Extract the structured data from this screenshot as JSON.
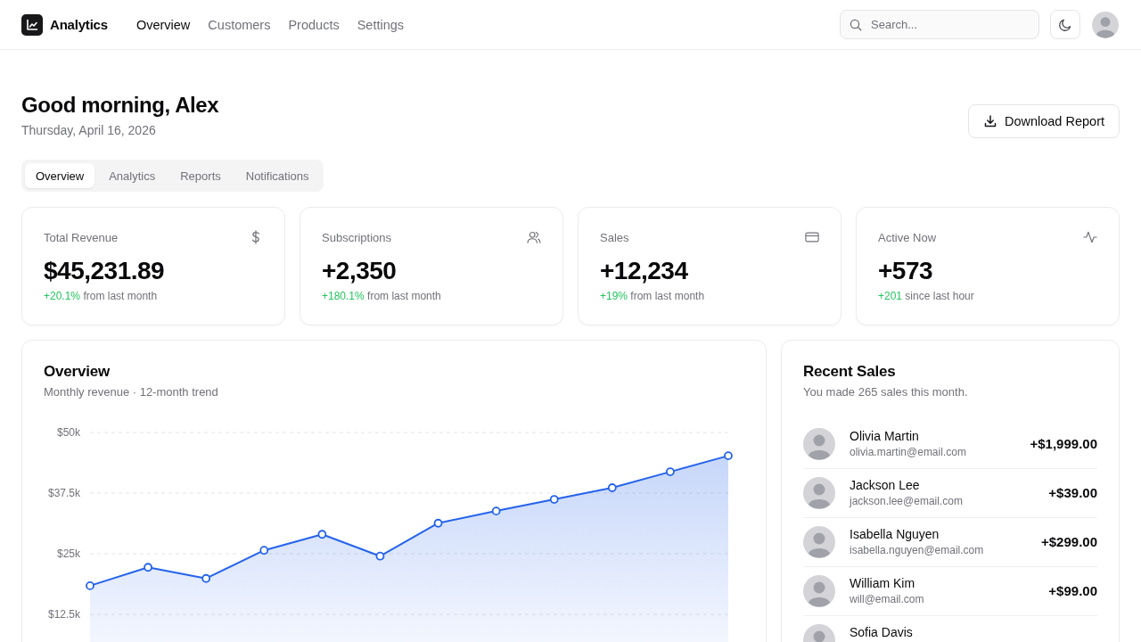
{
  "header": {
    "brand": "Analytics",
    "nav": [
      {
        "label": "Overview",
        "selected": true
      },
      {
        "label": "Customers",
        "selected": false
      },
      {
        "label": "Products",
        "selected": false
      },
      {
        "label": "Settings",
        "selected": false
      }
    ],
    "search": {
      "placeholder": "Search..."
    }
  },
  "greeting": {
    "title": "Good morning, Alex",
    "date": "Thursday, April 16, 2026",
    "button": "Download Report"
  },
  "tabs": [
    {
      "label": "Overview",
      "selected": true
    },
    {
      "label": "Analytics",
      "selected": false
    },
    {
      "label": "Reports",
      "selected": false
    },
    {
      "label": "Notifications",
      "selected": false
    }
  ],
  "stats": [
    {
      "kind": "money",
      "label": "Total Revenue",
      "value": "$45,231.89",
      "change": "+20.1%",
      "note": "from last month"
    },
    {
      "kind": "users",
      "label": "Subscriptions",
      "value": "+2,350",
      "change": "+180.1%",
      "note": "from last month"
    },
    {
      "kind": "card",
      "label": "Sales",
      "value": "+12,234",
      "change": "+19%",
      "note": "from last month"
    },
    {
      "kind": "activity",
      "label": "Active Now",
      "value": "+573",
      "change": "+201",
      "note": "since last hour"
    }
  ],
  "overview": {
    "title": "Overview",
    "subtitle": "Monthly revenue · 12-month trend",
    "chart_data": {
      "type": "area",
      "grid": true,
      "series": [
        {
          "color": "#2563eb",
          "values": [
            18400,
            22200,
            19900,
            25700,
            29000,
            24500,
            31300,
            33800,
            36200,
            38600,
            41900,
            45200
          ]
        }
      ],
      "ylim": [
        0,
        50000
      ],
      "yticks": [
        {
          "value": 12500,
          "label": "$12.5k"
        },
        {
          "value": 25000,
          "label": "$25k"
        },
        {
          "value": 37500,
          "label": "$37.5k"
        },
        {
          "value": 50000,
          "label": "$50k"
        }
      ]
    }
  },
  "recent_sales": {
    "title": "Recent Sales",
    "subtitle": "You made 265 sales this month.",
    "sales": [
      {
        "name": "Olivia Martin",
        "email": "olivia.martin@email.com",
        "amount": "+$1,999.00"
      },
      {
        "name": "Jackson Lee",
        "email": "jackson.lee@email.com",
        "amount": "+$39.00"
      },
      {
        "name": "Isabella Nguyen",
        "email": "isabella.nguyen@email.com",
        "amount": "+$299.00"
      },
      {
        "name": "William Kim",
        "email": "will@email.com",
        "amount": "+$99.00"
      },
      {
        "name": "Sofia Davis"
      }
    ]
  }
}
